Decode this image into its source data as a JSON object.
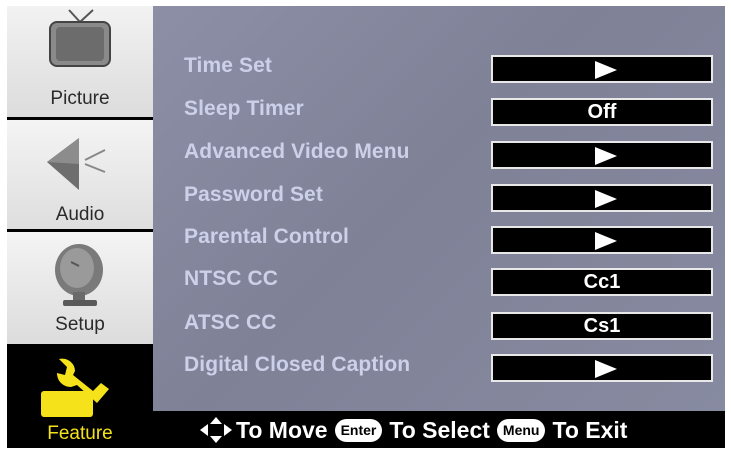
{
  "sidebar": {
    "tabs": [
      {
        "id": "picture",
        "label": "Picture",
        "icon": "tv-icon",
        "selected": false
      },
      {
        "id": "audio",
        "label": "Audio",
        "icon": "speaker-icon",
        "selected": false
      },
      {
        "id": "setup",
        "label": "Setup",
        "icon": "satellite-dish-icon",
        "selected": false
      },
      {
        "id": "feature",
        "label": "Feature",
        "icon": "wrench-icon",
        "selected": true
      }
    ]
  },
  "menu": {
    "items": [
      {
        "label": "Time Set",
        "value": "",
        "type": "arrow"
      },
      {
        "label": "Sleep Timer",
        "value": "Off",
        "type": "value"
      },
      {
        "label": "Advanced Video Menu",
        "value": "",
        "type": "arrow"
      },
      {
        "label": "Password Set",
        "value": "",
        "type": "arrow"
      },
      {
        "label": "Parental Control",
        "value": "",
        "type": "arrow"
      },
      {
        "label": "NTSC CC",
        "value": "Cc1",
        "type": "value"
      },
      {
        "label": "ATSC CC",
        "value": "Cs1",
        "type": "value"
      },
      {
        "label": "Digital Closed Caption",
        "value": "",
        "type": "arrow"
      }
    ]
  },
  "footer": {
    "move_text": "To Move",
    "enter_key": "Enter",
    "select_text": "To Select",
    "menu_key": "Menu",
    "exit_text": "To Exit"
  },
  "colors": {
    "panel": "#8488a0",
    "label_text": "#cdd0e9",
    "selected_tab_text": "#f5e21a",
    "value_box": "#000000"
  }
}
